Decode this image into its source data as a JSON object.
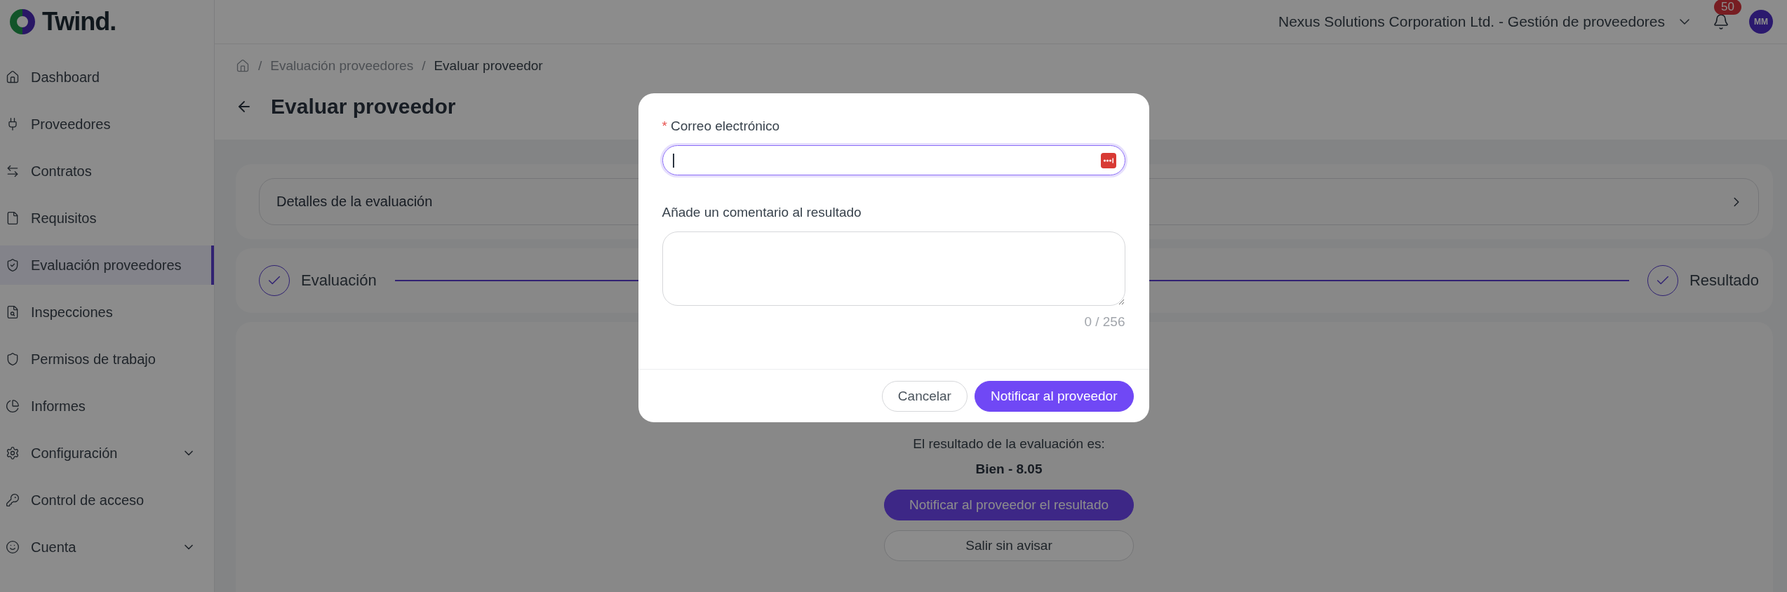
{
  "logo": {
    "text": "Twind."
  },
  "header": {
    "organization": "Nexus Solutions Corporation Ltd. - Gestión de proveedores",
    "notifications": "50",
    "avatar": "MM"
  },
  "sidebar": {
    "items": [
      {
        "label": "Dashboard",
        "selected": false,
        "expandable": false
      },
      {
        "label": "Proveedores",
        "selected": false,
        "expandable": false
      },
      {
        "label": "Contratos",
        "selected": false,
        "expandable": false
      },
      {
        "label": "Requisitos",
        "selected": false,
        "expandable": false
      },
      {
        "label": "Evaluación proveedores",
        "selected": true,
        "expandable": false
      },
      {
        "label": "Inspecciones",
        "selected": false,
        "expandable": false
      },
      {
        "label": "Permisos de trabajo",
        "selected": false,
        "expandable": false
      },
      {
        "label": "Informes",
        "selected": false,
        "expandable": false
      },
      {
        "label": "Configuración",
        "selected": false,
        "expandable": true
      },
      {
        "label": "Control de acceso",
        "selected": false,
        "expandable": false
      },
      {
        "label": "Cuenta",
        "selected": false,
        "expandable": true
      }
    ]
  },
  "breadcrumb": [
    {
      "separator": "/",
      "label": "Evaluación proveedores"
    },
    {
      "separator": "/",
      "label": "Evaluar proveedor"
    }
  ],
  "title": "Evaluar proveedor",
  "details": {
    "label": "Detalles de la evaluación"
  },
  "steps": [
    {
      "label": "Evaluación",
      "done": true
    },
    {
      "label": "Resultado",
      "done": true
    }
  ],
  "result": {
    "label": "El resultado de la evaluación es:",
    "value": "Bien - 8.05",
    "buttons": [
      {
        "label": "Notificar al proveedor el resultado",
        "kind": "primary"
      },
      {
        "label": "Salir sin avisar",
        "kind": "secondary"
      }
    ]
  },
  "modal": {
    "fields": [
      {
        "kind": "input",
        "label": "Correo electrónico",
        "required_mark": "*",
        "focused": true
      },
      {
        "kind": "textarea",
        "label": "Añade un comentario al resultado",
        "counter": "0 / 256"
      }
    ],
    "buttons": [
      {
        "label": "Cancelar",
        "kind": "secondary"
      },
      {
        "label": "Notificar al proveedor",
        "kind": "primary"
      }
    ]
  }
}
